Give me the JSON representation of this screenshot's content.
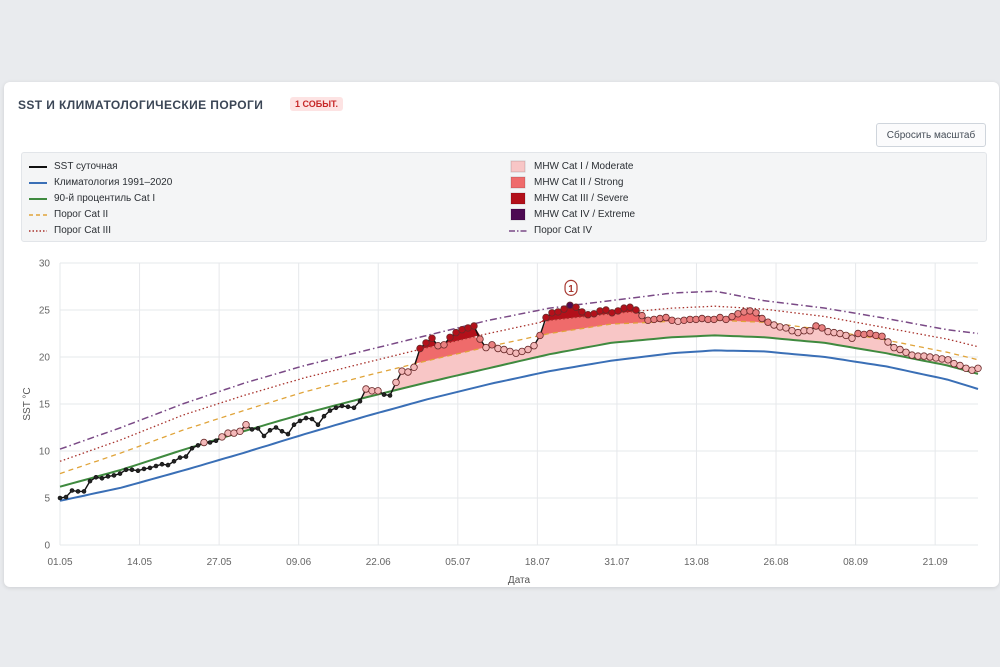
{
  "card": {
    "title": "SST И КЛИМАТОЛОГИЧЕСКИЕ ПОРОГИ",
    "badge": "1 СОБЫТ.",
    "reset_button": "Сбросить масштаб"
  },
  "colors": {
    "sst": "#111111",
    "climatology": "#3a6fb6",
    "p90": "#3f8a3f",
    "cat2_threshold": "#e0a43a",
    "cat3_threshold": "#a8322c",
    "cat4_threshold": "#7a4a86",
    "cat1_fill": "#f8c6c6",
    "cat2_fill": "#ef6b6b",
    "cat3_fill": "#b3101a",
    "cat4_fill": "#4d0a52"
  },
  "legend": {
    "left": [
      {
        "label": "SST суточная",
        "style": "solid",
        "color_key": "sst"
      },
      {
        "label": "Климатология 1991–2020",
        "style": "solid",
        "color_key": "climatology"
      },
      {
        "label": "90-й процентиль Cat I",
        "style": "solid",
        "color_key": "p90"
      },
      {
        "label": "Порог Cat II",
        "style": "dashed",
        "color_key": "cat2_threshold"
      },
      {
        "label": "Порог Cat III",
        "style": "dotted",
        "color_key": "cat3_threshold"
      }
    ],
    "right": [
      {
        "label": "MHW Cat I / Moderate",
        "style": "box",
        "color_key": "cat1_fill"
      },
      {
        "label": "MHW Cat II / Strong",
        "style": "box",
        "color_key": "cat2_fill"
      },
      {
        "label": "MHW Cat III / Severe",
        "style": "box",
        "color_key": "cat3_fill"
      },
      {
        "label": "MHW Cat IV / Extreme",
        "style": "box",
        "color_key": "cat4_fill"
      },
      {
        "label": "Порог Cat IV",
        "style": "dashdot",
        "color_key": "cat4_threshold"
      }
    ]
  },
  "chart_data": {
    "type": "line",
    "xlabel": "Дата",
    "ylabel": "SST °C",
    "ylim": [
      0,
      30
    ],
    "yticks": [
      0,
      5,
      10,
      15,
      20,
      25,
      30
    ],
    "grid": true,
    "x_range_days": [
      0,
      150
    ],
    "x_ticks": [
      {
        "day": 0,
        "label": "01.05"
      },
      {
        "day": 13,
        "label": "14.05"
      },
      {
        "day": 26,
        "label": "27.05"
      },
      {
        "day": 39,
        "label": "09.06"
      },
      {
        "day": 52,
        "label": "22.06"
      },
      {
        "day": 65,
        "label": "05.07"
      },
      {
        "day": 78,
        "label": "18.07"
      },
      {
        "day": 91,
        "label": "31.07"
      },
      {
        "day": 104,
        "label": "13.08"
      },
      {
        "day": 117,
        "label": "26.08"
      },
      {
        "day": 130,
        "label": "08.09"
      },
      {
        "day": 143,
        "label": "21.09"
      }
    ],
    "event_marker": {
      "label": "1",
      "day": 83.5,
      "value": 27.3
    },
    "climatology": {
      "name": "Климатология 1991–2020",
      "points": [
        [
          0,
          4.7
        ],
        [
          10,
          6.1
        ],
        [
          20,
          7.9
        ],
        [
          30,
          9.8
        ],
        [
          40,
          11.8
        ],
        [
          50,
          13.7
        ],
        [
          60,
          15.5
        ],
        [
          70,
          17.1
        ],
        [
          80,
          18.5
        ],
        [
          90,
          19.6
        ],
        [
          100,
          20.4
        ],
        [
          107,
          20.7
        ],
        [
          115,
          20.6
        ],
        [
          125,
          20.0
        ],
        [
          135,
          19.0
        ],
        [
          145,
          17.6
        ],
        [
          150,
          16.6
        ]
      ]
    },
    "p90": {
      "name": "90-й процентиль Cat I",
      "points": [
        [
          0,
          6.2
        ],
        [
          10,
          8.0
        ],
        [
          20,
          10.1
        ],
        [
          30,
          12.1
        ],
        [
          40,
          14.0
        ],
        [
          50,
          15.7
        ],
        [
          60,
          17.3
        ],
        [
          70,
          18.8
        ],
        [
          80,
          20.3
        ],
        [
          90,
          21.5
        ],
        [
          100,
          22.1
        ],
        [
          107,
          22.3
        ],
        [
          115,
          22.1
        ],
        [
          125,
          21.5
        ],
        [
          135,
          20.4
        ],
        [
          145,
          19.1
        ],
        [
          150,
          18.2
        ]
      ]
    },
    "cat2": {
      "name": "Порог Cat II",
      "points": [
        [
          0,
          7.6
        ],
        [
          10,
          9.8
        ],
        [
          20,
          12.2
        ],
        [
          30,
          14.3
        ],
        [
          40,
          16.3
        ],
        [
          50,
          18.0
        ],
        [
          60,
          19.6
        ],
        [
          70,
          21.1
        ],
        [
          80,
          22.5
        ],
        [
          90,
          23.5
        ],
        [
          100,
          23.8
        ],
        [
          107,
          23.9
        ],
        [
          115,
          23.7
        ],
        [
          125,
          22.9
        ],
        [
          135,
          21.8
        ],
        [
          145,
          20.5
        ],
        [
          150,
          19.7
        ]
      ]
    },
    "cat3": {
      "name": "Порог Cat III",
      "points": [
        [
          0,
          8.9
        ],
        [
          10,
          11.2
        ],
        [
          20,
          13.8
        ],
        [
          30,
          15.9
        ],
        [
          40,
          17.8
        ],
        [
          50,
          19.4
        ],
        [
          60,
          21.0
        ],
        [
          70,
          22.5
        ],
        [
          80,
          23.9
        ],
        [
          90,
          24.6
        ],
        [
          100,
          25.2
        ],
        [
          107,
          25.4
        ],
        [
          115,
          25.1
        ],
        [
          125,
          24.3
        ],
        [
          135,
          23.1
        ],
        [
          145,
          21.9
        ],
        [
          150,
          21.1
        ]
      ]
    },
    "cat4": {
      "name": "Порог Cat IV",
      "points": [
        [
          0,
          10.2
        ],
        [
          10,
          12.5
        ],
        [
          20,
          15.0
        ],
        [
          30,
          17.2
        ],
        [
          40,
          19.1
        ],
        [
          50,
          20.7
        ],
        [
          60,
          22.3
        ],
        [
          70,
          23.9
        ],
        [
          80,
          25.2
        ],
        [
          90,
          26.0
        ],
        [
          100,
          26.8
        ],
        [
          107,
          27.0
        ],
        [
          115,
          26.0
        ],
        [
          125,
          25.2
        ],
        [
          135,
          24.1
        ],
        [
          145,
          22.9
        ],
        [
          150,
          22.5
        ]
      ]
    },
    "sst": {
      "name": "SST суточная",
      "values": [
        5.0,
        5.1,
        5.8,
        5.7,
        5.7,
        6.8,
        7.2,
        7.1,
        7.3,
        7.4,
        7.6,
        8.0,
        8.0,
        7.9,
        8.1,
        8.2,
        8.4,
        8.6,
        8.5,
        8.9,
        9.3,
        9.4,
        10.3,
        10.6,
        10.9,
        10.9,
        11.1,
        11.5,
        11.9,
        11.9,
        12.1,
        12.8,
        12.3,
        12.4,
        11.6,
        12.2,
        12.5,
        12.1,
        11.8,
        12.8,
        13.2,
        13.5,
        13.4,
        12.8,
        13.7,
        14.3,
        14.6,
        14.8,
        14.7,
        14.6,
        15.3,
        16.6,
        16.4,
        16.4,
        16.0,
        15.9,
        17.3,
        18.5,
        18.4,
        18.9,
        20.9,
        21.5,
        22.0,
        21.2,
        21.3,
        22.1,
        22.6,
        22.9,
        23.1,
        23.3,
        21.9,
        21.0,
        21.3,
        20.9,
        20.8,
        20.6,
        20.4,
        20.6,
        20.8,
        21.2,
        22.3,
        24.2,
        24.7,
        24.8,
        25.1,
        25.5,
        25.3,
        24.8,
        24.5,
        24.6,
        24.9,
        25.0,
        24.7,
        24.9,
        25.2,
        25.3,
        25.0,
        24.4,
        23.9,
        24.0,
        24.1,
        24.2,
        23.9,
        23.8,
        23.9,
        24.0,
        24.0,
        24.1,
        24.0,
        24.0,
        24.2,
        24.0,
        24.3,
        24.6,
        24.8,
        24.9,
        24.7,
        24.1,
        23.7,
        23.4,
        23.2,
        23.1,
        22.8,
        22.6,
        22.8,
        22.8,
        23.3,
        23.1,
        22.7,
        22.6,
        22.5,
        22.3,
        22.0,
        22.5,
        22.4,
        22.5,
        22.3,
        22.2,
        21.6,
        21.0,
        20.8,
        20.5,
        20.2,
        20.1,
        20.1,
        20.0,
        19.9,
        19.8,
        19.7,
        19.3,
        19.1,
        18.8,
        18.6,
        18.8
      ]
    }
  }
}
